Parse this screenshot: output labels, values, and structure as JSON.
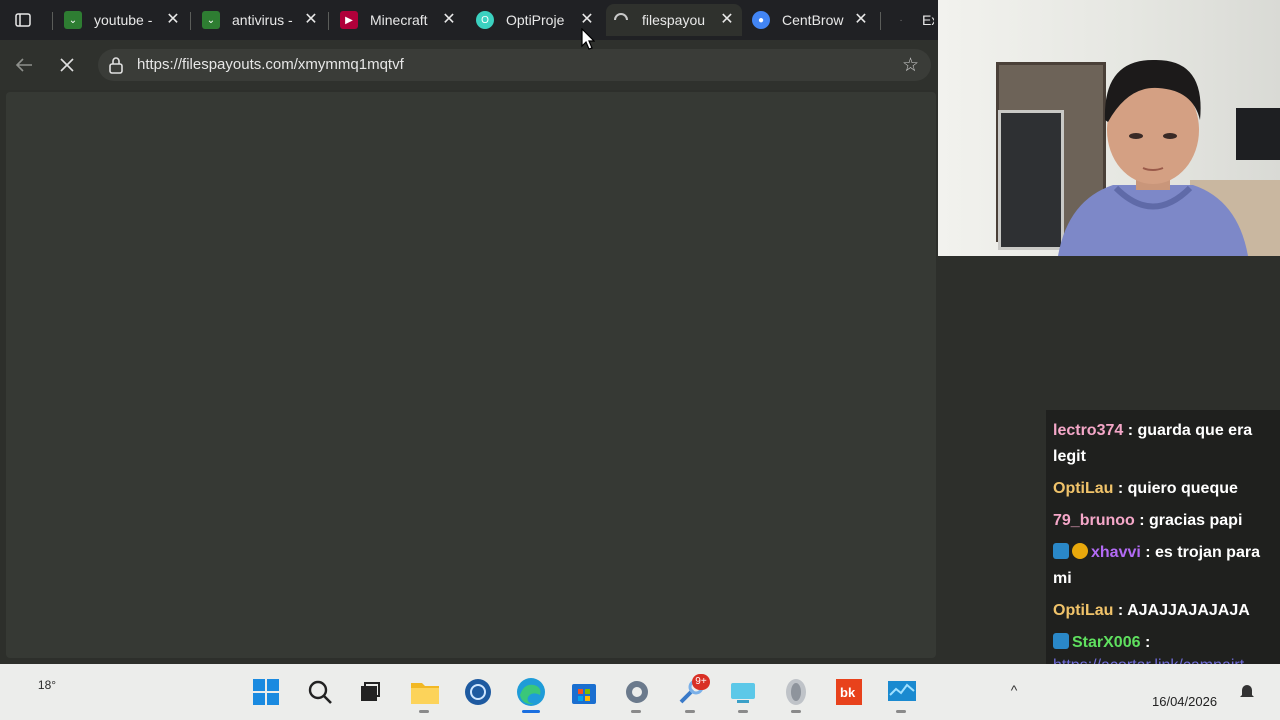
{
  "browser": {
    "tabs": [
      {
        "title": "youtube -",
        "favicon_color": "#2e7d32"
      },
      {
        "title": "antivirus -",
        "favicon_color": "#2e7d32"
      },
      {
        "title": "Minecraft",
        "favicon_color": "#b0003a"
      },
      {
        "title": "OptiProje",
        "favicon_color": "#3bd1c0"
      },
      {
        "title": "filespayou",
        "favicon_color": "#9aa0a6",
        "active": true,
        "loading": true
      },
      {
        "title": "CentBrow",
        "favicon_color": "#4285f4"
      },
      {
        "title": "Ext",
        "favicon_color": "#5f6368"
      }
    ],
    "url": "https://filespayouts.com/xmymmq1mqtvf"
  },
  "chat": {
    "messages": [
      {
        "user": "lectro374",
        "user_color": "#f4a7c8",
        "sep": " : ",
        "text": "guarda que era legit"
      },
      {
        "user": "OptiLau",
        "user_color": "#f0c36a",
        "sep": " : ",
        "text": "quiero queque"
      },
      {
        "user": "79_brunoo",
        "user_color": "#f4a7c8",
        "sep": " : ",
        "text": "gracias papi"
      },
      {
        "user": "xhavvi",
        "user_color": "#b36bf5",
        "sep": " : ",
        "text": "es trojan para mi",
        "badges": [
          "prime",
          "sub"
        ]
      },
      {
        "user": "OptiLau",
        "user_color": "#f0c36a",
        "sep": " : ",
        "text": "AJAJJAJAJAJA"
      },
      {
        "user": "StarX006",
        "user_color": "#5fe05f",
        "sep": " :",
        "text": "",
        "badges": [
          "prime"
        ]
      },
      {
        "user": "",
        "user_color": "#6f6bd8",
        "sep": "",
        "text": "https://acortar.link/camnairt rojan",
        "is_link": true
      }
    ]
  },
  "taskbar": {
    "weather": "18°",
    "notification_badge": "9+",
    "date": "16/04/2026",
    "apps": [
      "start-icon",
      "search-icon",
      "task-view-icon",
      "file-explorer-icon",
      "app-icon",
      "edge-icon",
      "store-icon",
      "settings-icon",
      "tools-icon",
      "app2-icon",
      "app3-icon",
      "bk-icon",
      "monitor-icon"
    ]
  }
}
